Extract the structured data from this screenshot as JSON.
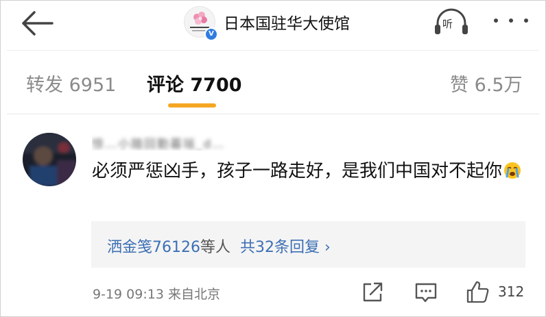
{
  "header": {
    "account_name": "日本国驻华大使馆",
    "logo_text": "日本国驻华大使馆",
    "verified_badge": "V",
    "listen_label": "听",
    "back_icon": "back-arrow-icon",
    "more_icon": "more-dots-icon"
  },
  "tabs": [
    {
      "label": "转发 6951"
    },
    {
      "label": "评论 7700"
    },
    {
      "label": "赞 6.5万"
    }
  ],
  "active_tab": "评论 7700",
  "accent_color": "#f5a623",
  "link_color": "#3c6fb4",
  "comment": {
    "username": "惊…小踏回勤暮瑶_d…",
    "username_obscured": true,
    "text": "必须严惩凶手，孩子一路走好，是我们中国对不起你",
    "emoji": "crying-face-emoji",
    "replies": {
      "first_replier": "洒金笺76126",
      "others_label": "等人",
      "count_label": "共32条回复",
      "chevron": "›"
    },
    "timestamp": "9-19 09:13",
    "source": "来自北京",
    "like_count": "312"
  }
}
